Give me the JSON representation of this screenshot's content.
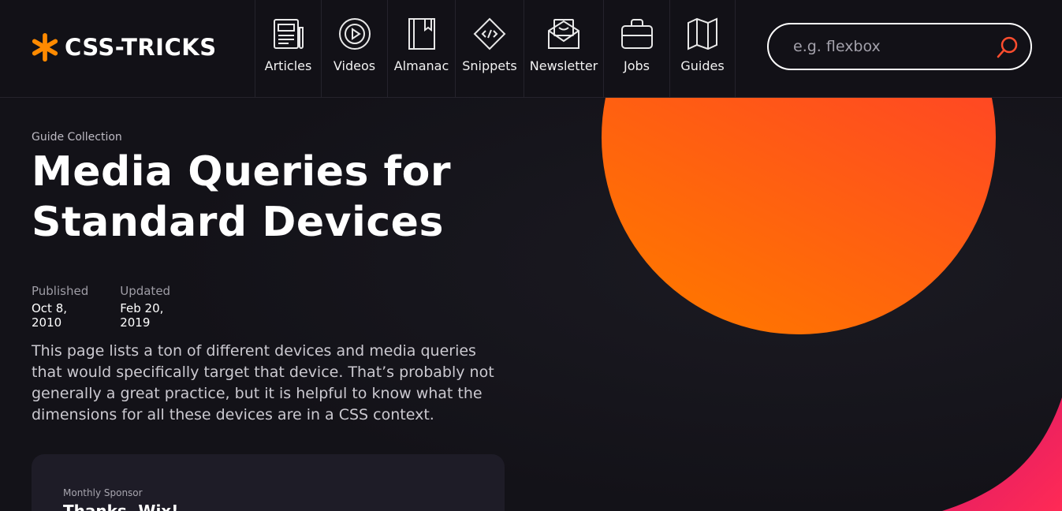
{
  "header": {
    "logo_text": "CSS-TRICKS",
    "nav": [
      {
        "label": "Articles",
        "icon": "newspaper-icon"
      },
      {
        "label": "Videos",
        "icon": "play-circle-icon"
      },
      {
        "label": "Almanac",
        "icon": "book-icon"
      },
      {
        "label": "Snippets",
        "icon": "code-diamond-icon"
      },
      {
        "label": "Newsletter",
        "icon": "envelope-icon"
      },
      {
        "label": "Jobs",
        "icon": "briefcase-icon"
      },
      {
        "label": "Guides",
        "icon": "map-icon"
      }
    ],
    "search": {
      "placeholder": "e.g. flexbox"
    }
  },
  "article": {
    "eyebrow": "Guide Collection",
    "title": "Media Queries for Standard Devices",
    "published_label": "Published",
    "published_date": "Oct 8, 2010",
    "updated_label": "Updated",
    "updated_date": "Feb 20, 2019",
    "intro": "This page lists a ton of different devices and media queries that would specifically target that device. That’s probably not generally a great practice, but it is helpful to know what the dimensions for all these devices are in a CSS context."
  },
  "sponsor": {
    "label": "Monthly Sponsor",
    "title": "Thanks, Wix!"
  },
  "colors": {
    "background": "#131218",
    "accent_orange": "#ff7a00",
    "accent_red": "#ff3b30",
    "accent_pink": "#e0195f",
    "logo_star": "#ff8a00"
  }
}
